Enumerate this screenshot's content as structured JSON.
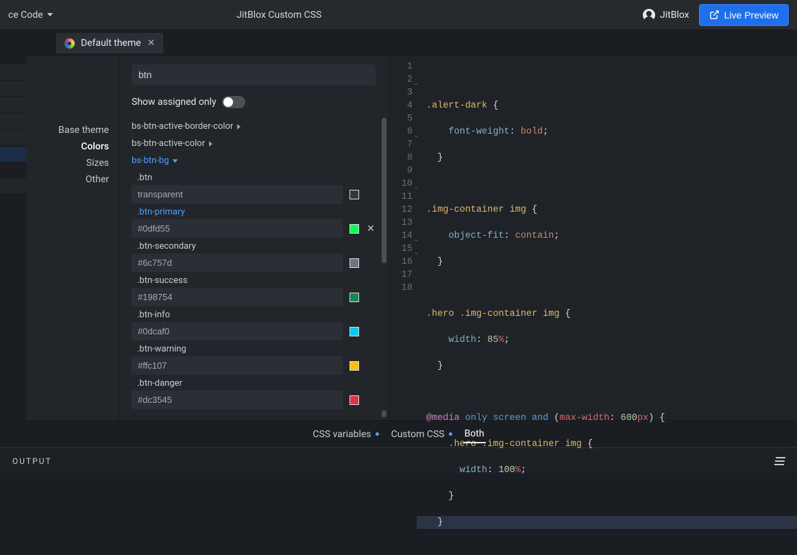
{
  "topbar": {
    "left_label": "ce Code",
    "title": "JitBlox Custom CSS",
    "user": "JitBlox",
    "live_preview": "Live Preview"
  },
  "tab": {
    "label": "Default theme"
  },
  "sidebar": {
    "items": [
      "Base theme",
      "Colors",
      "Sizes",
      "Other"
    ],
    "active_index": 1
  },
  "vars": {
    "search_value": "btn",
    "show_assigned_label": "Show assigned only",
    "groups": [
      {
        "name": "bs-btn-active-border-color",
        "expanded": false
      },
      {
        "name": "bs-btn-active-color",
        "expanded": false
      },
      {
        "name": "bs-btn-bg",
        "expanded": true
      }
    ],
    "entries": [
      {
        "cls": ".btn",
        "value": "transparent",
        "swatch": "transparent",
        "link": false,
        "clearable": false
      },
      {
        "cls": ".btn-primary",
        "value": "#0dfd55",
        "swatch": "#0dfd55",
        "link": true,
        "clearable": true
      },
      {
        "cls": ".btn-secondary",
        "value": "#6c757d",
        "swatch": "#6c757d",
        "link": false,
        "clearable": false
      },
      {
        "cls": ".btn-success",
        "value": "#198754",
        "swatch": "#198754",
        "link": false,
        "clearable": false
      },
      {
        "cls": ".btn-info",
        "value": "#0dcaf0",
        "swatch": "#0dcaf0",
        "link": false,
        "clearable": false
      },
      {
        "cls": ".btn-warning",
        "value": "#ffc107",
        "swatch": "#ffc107",
        "link": false,
        "clearable": false
      },
      {
        "cls": ".btn-danger",
        "value": "#dc3545",
        "swatch": "#dc3545",
        "link": false,
        "clearable": false
      }
    ]
  },
  "editor_lines": 18,
  "bottom_tabs": {
    "items": [
      "CSS variables",
      "Custom CSS",
      "Both"
    ],
    "active_index": 2
  },
  "output_label": "OUTPUT"
}
